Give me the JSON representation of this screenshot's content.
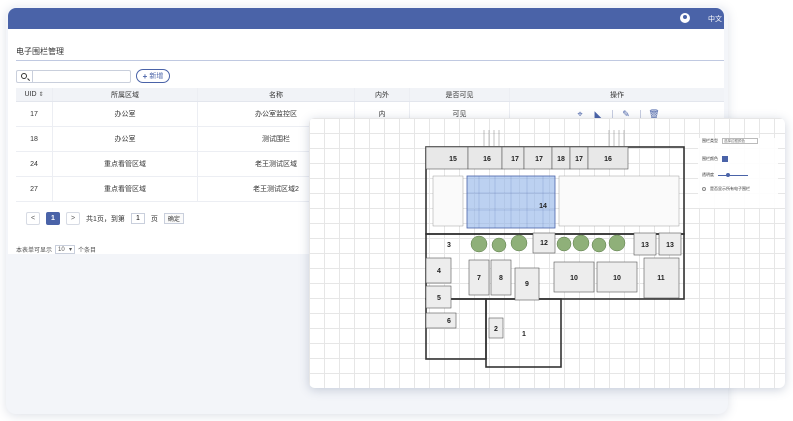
{
  "header": {
    "lang_label": "中文"
  },
  "page": {
    "title": "电子围栏管理"
  },
  "toolbar": {
    "search_placeholder": "",
    "add_label": "新增"
  },
  "table": {
    "columns": [
      "UID",
      "所属区域",
      "名称",
      "内外",
      "是否可见",
      "操作"
    ],
    "rows": [
      {
        "uid": "17",
        "area": "办公室",
        "name": "办公室监控区",
        "inout": "内",
        "visible": "可见"
      },
      {
        "uid": "18",
        "area": "办公室",
        "name": "测试围栏",
        "inout": "",
        "visible": ""
      },
      {
        "uid": "24",
        "area": "重点看管区域",
        "name": "老王测试区域",
        "inout": "",
        "visible": ""
      },
      {
        "uid": "27",
        "area": "重点看管区域",
        "name": "老王测试区域2",
        "inout": "",
        "visible": ""
      }
    ]
  },
  "pager": {
    "prev": "<",
    "current": "1",
    "next": ">",
    "total_text": "共1页，到第",
    "jump_value": "1",
    "page_unit": "页",
    "confirm": "确定"
  },
  "perpage": {
    "prefix": "本表单可显示",
    "value": "10",
    "suffix": "个条目"
  },
  "plan": {
    "settings": {
      "fence_style_label": "围栏类型",
      "fence_style_value": "选择边框颜色",
      "color_label": "围栏颜色",
      "opacity_label": "透明度",
      "hint": "是否显示所有电子围栏"
    },
    "room_labels": [
      "15",
      "16",
      "17",
      "17",
      "18",
      "17",
      "16",
      "14",
      "12",
      "13",
      "13",
      "3",
      "4",
      "5",
      "6",
      "7",
      "8",
      "9",
      "10",
      "10",
      "11",
      "2",
      "1"
    ]
  },
  "colors": {
    "brand": "#4a63a8",
    "fence_fill": "#8fb3e8"
  }
}
